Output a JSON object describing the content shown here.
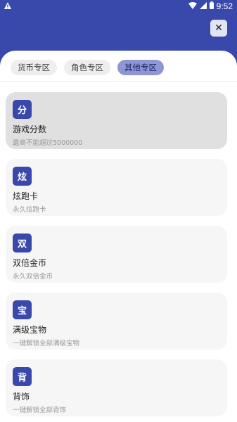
{
  "status": {
    "time": "9:52",
    "icons": [
      "notification-icon",
      "wifi-icon",
      "signal-icon",
      "battery-icon"
    ]
  },
  "close_label": "✕",
  "tabs": [
    {
      "label": "货币专区",
      "active": false
    },
    {
      "label": "角色专区",
      "active": false
    },
    {
      "label": "其他专区",
      "active": true
    }
  ],
  "items": [
    {
      "badge": "分",
      "title": "游戏分数",
      "subtitle": "最高不能超过5000000",
      "selected": true
    },
    {
      "badge": "炫",
      "title": "炫跑卡",
      "subtitle": "永久炫跑卡",
      "selected": false
    },
    {
      "badge": "双",
      "title": "双倍金币",
      "subtitle": "永久双倍金币",
      "selected": false
    },
    {
      "badge": "宝",
      "title": "满级宝物",
      "subtitle": "一键解锁全部满级宝物",
      "selected": false
    },
    {
      "badge": "背",
      "title": "背饰",
      "subtitle": "一键解锁全部背饰",
      "selected": false
    }
  ],
  "colors": {
    "header": "#3949ab",
    "active_tab": "#8f96d6",
    "badge": "#3949ab"
  }
}
